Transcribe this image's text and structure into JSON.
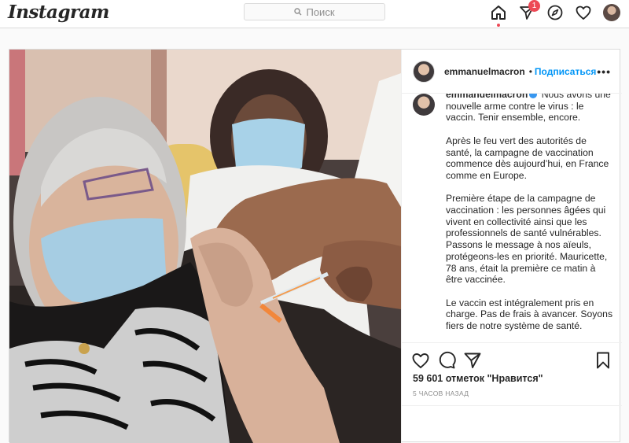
{
  "app": {
    "logo": "Instagram"
  },
  "search": {
    "placeholder": "Поиск",
    "icon": "search-icon"
  },
  "nav": {
    "icons": [
      "home-icon",
      "direct-icon",
      "explore-icon",
      "heart-icon",
      "profile-avatar"
    ],
    "direct_badge": "1"
  },
  "post": {
    "username": "emmanuelmacron",
    "separator": "•",
    "follow_label": "Подписаться",
    "more_label": "•••",
    "caption": {
      "username": "emmanuelmacron",
      "p1": "Nous avons une nouvelle arme contre le virus : le vaccin. Tenir ensemble, encore.",
      "p2": "Après le feu vert des autorités de santé, la campagne de vaccination commence dès aujourd’hui, en France comme en Europe.",
      "p3": "Première étape de la campagne de vaccination : les personnes âgées qui vivent en collectivité ainsi que les professionnels de santé vulnérables. Passons le message à nos aïeuls, protégeons-les en priorité. Mauricette, 78 ans, était la première ce matin à être vaccinée.",
      "p4": "Le vaccin est intégralement pris en charge. Pas de frais à avancer. Soyons fiers de notre système de santé."
    },
    "likes": "59 601 отметок \"Нравится\"",
    "time": "5 ЧАСОВ НАЗАД"
  },
  "colors": {
    "accent": "#0095f6",
    "badge": "#ed4956",
    "border": "#dbdbdb"
  }
}
